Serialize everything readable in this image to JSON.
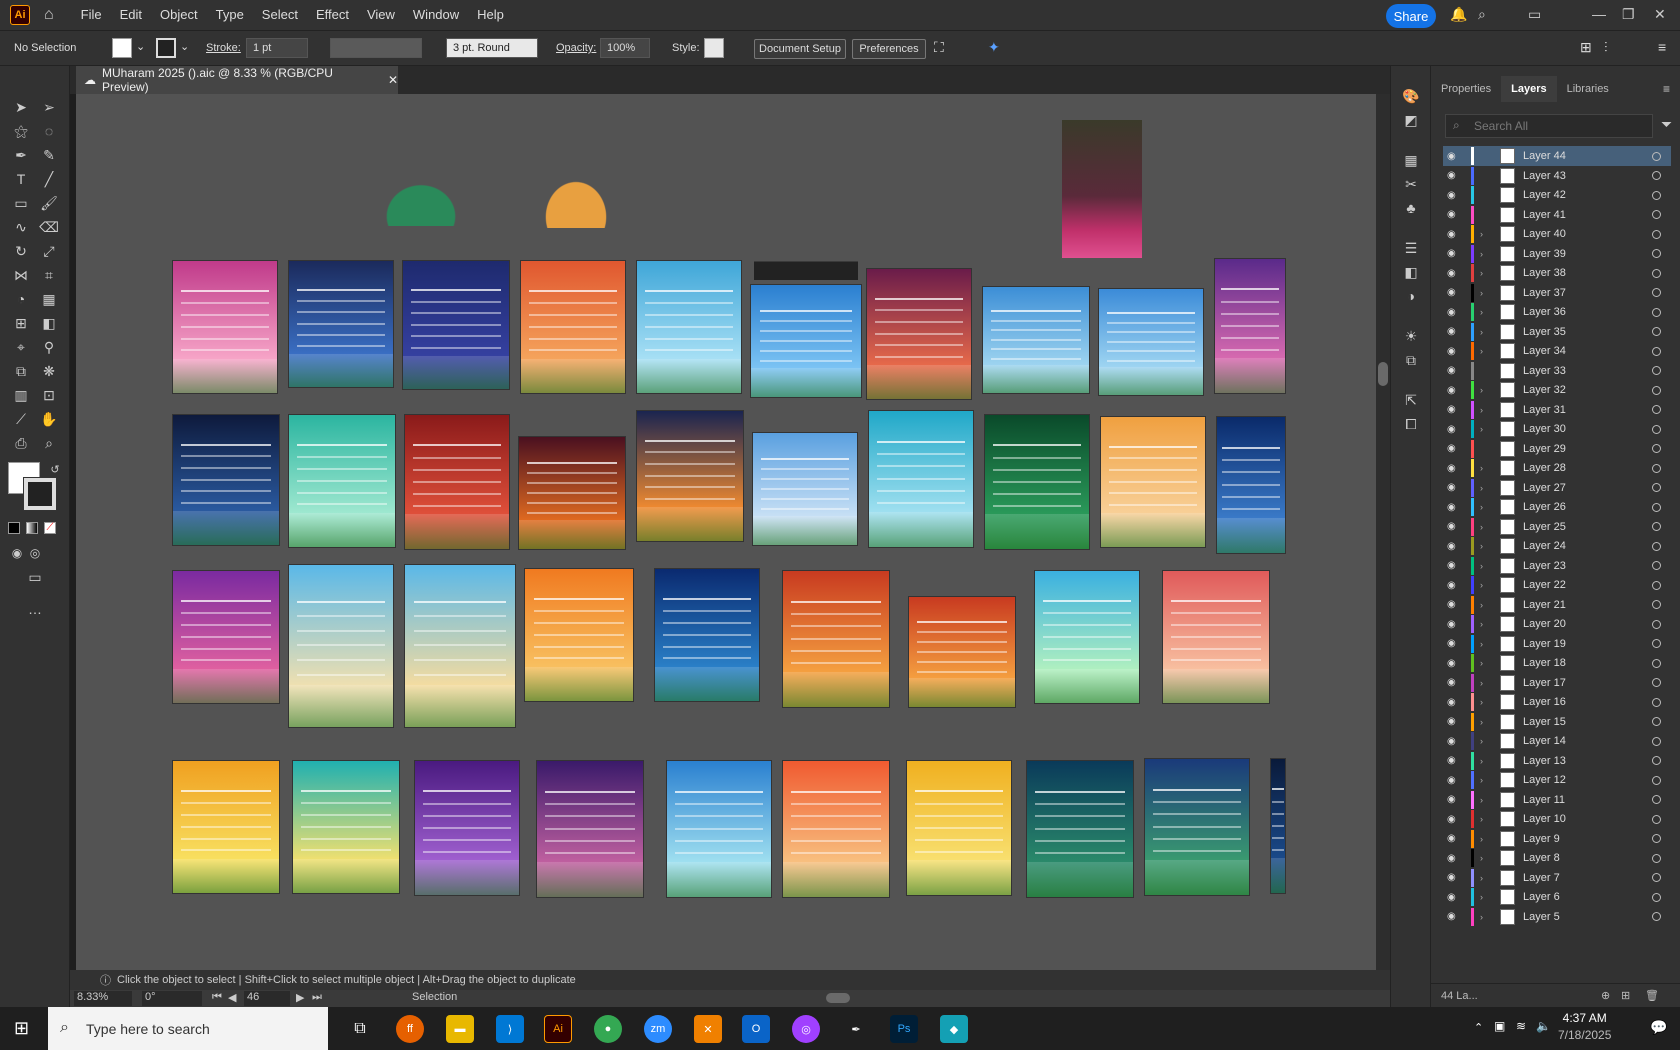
{
  "menubar": {
    "logo": "Ai",
    "items": [
      "File",
      "Edit",
      "Object",
      "Type",
      "Select",
      "Effect",
      "View",
      "Window",
      "Help"
    ],
    "share_label": "Share"
  },
  "control": {
    "selection": "No Selection",
    "stroke_label": "Stroke:",
    "stroke_value": "1 pt",
    "brush_value": "3 pt. Round",
    "opacity_label": "Opacity:",
    "opacity_value": "100%",
    "style_label": "Style:",
    "doc_setup": "Document Setup",
    "preferences": "Preferences"
  },
  "document": {
    "tab_title": "MUharam 2025 ().aic @ 8.33 % (RGB/CPU Preview)",
    "status_text": "Click the object to select  |  Shift+Click to select multiple object  |  Alt+Drag the object to duplicate",
    "zoom": "8.33%",
    "rotate": "0°",
    "artboard": "46",
    "mode": "Selection"
  },
  "panel": {
    "tabs": [
      "Properties",
      "Layers",
      "Libraries"
    ],
    "active_tab": "Layers",
    "search_placeholder": "Search All",
    "footer": "44 La...",
    "layers": [
      {
        "name": "Layer 44",
        "color": "#ffffff",
        "selected": true,
        "expand": false
      },
      {
        "name": "Layer 43",
        "color": "#4b6bff",
        "expand": false
      },
      {
        "name": "Layer 42",
        "color": "#28c8e6",
        "expand": false
      },
      {
        "name": "Layer 41",
        "color": "#ff4dc4",
        "expand": false
      },
      {
        "name": "Layer 40",
        "color": "#ffb000",
        "expand": true
      },
      {
        "name": "Layer 39",
        "color": "#7c3cff",
        "expand": true
      },
      {
        "name": "Layer 38",
        "color": "#e04040",
        "expand": true
      },
      {
        "name": "Layer 37",
        "color": "#000000",
        "expand": true
      },
      {
        "name": "Layer 36",
        "color": "#28d070",
        "expand": true
      },
      {
        "name": "Layer 35",
        "color": "#2ea0ff",
        "expand": true
      },
      {
        "name": "Layer 34",
        "color": "#ff6a00",
        "expand": true
      },
      {
        "name": "Layer 33",
        "color": "#888888",
        "expand": false
      },
      {
        "name": "Layer 32",
        "color": "#40e040",
        "expand": true
      },
      {
        "name": "Layer 31",
        "color": "#d050ff",
        "expand": true
      },
      {
        "name": "Layer 30",
        "color": "#00b0c0",
        "expand": true
      },
      {
        "name": "Layer 29",
        "color": "#ff5050",
        "expand": false
      },
      {
        "name": "Layer 28",
        "color": "#ffe040",
        "expand": true
      },
      {
        "name": "Layer 27",
        "color": "#6060ff",
        "expand": true
      },
      {
        "name": "Layer 26",
        "color": "#30c0ff",
        "expand": true
      },
      {
        "name": "Layer 25",
        "color": "#ff4080",
        "expand": true
      },
      {
        "name": "Layer 24",
        "color": "#9b9b20",
        "expand": true
      },
      {
        "name": "Layer 23",
        "color": "#00c080",
        "expand": true
      },
      {
        "name": "Layer 22",
        "color": "#4040ff",
        "expand": true
      },
      {
        "name": "Layer 21",
        "color": "#ff8000",
        "expand": true
      },
      {
        "name": "Layer 20",
        "color": "#a060ff",
        "expand": true
      },
      {
        "name": "Layer 19",
        "color": "#00a0ff",
        "expand": true
      },
      {
        "name": "Layer 18",
        "color": "#60c020",
        "expand": true
      },
      {
        "name": "Layer 17",
        "color": "#c040c0",
        "expand": true
      },
      {
        "name": "Layer 16",
        "color": "#ff9090",
        "expand": true
      },
      {
        "name": "Layer 15",
        "color": "#ffa000",
        "expand": true
      },
      {
        "name": "Layer 14",
        "color": "#404080",
        "expand": true
      },
      {
        "name": "Layer 13",
        "color": "#30e0a0",
        "expand": true
      },
      {
        "name": "Layer 12",
        "color": "#5070ff",
        "expand": true
      },
      {
        "name": "Layer 11",
        "color": "#ff70ff",
        "expand": true
      },
      {
        "name": "Layer 10",
        "color": "#e03030",
        "expand": true
      },
      {
        "name": "Layer 9",
        "color": "#ff8c00",
        "expand": true
      },
      {
        "name": "Layer 8",
        "color": "#000000",
        "expand": true
      },
      {
        "name": "Layer 7",
        "color": "#9090ff",
        "expand": true
      },
      {
        "name": "Layer 6",
        "color": "#20c0e0",
        "expand": true
      },
      {
        "name": "Layer 5",
        "color": "#ff40c0",
        "expand": true
      }
    ]
  },
  "taskbar": {
    "search_placeholder": "Type here to search",
    "time": "4:37 AM",
    "date": "7/18/2025"
  },
  "palette": {
    "accent": "#1473e6",
    "canvas": "#535353",
    "panel": "#323232"
  }
}
